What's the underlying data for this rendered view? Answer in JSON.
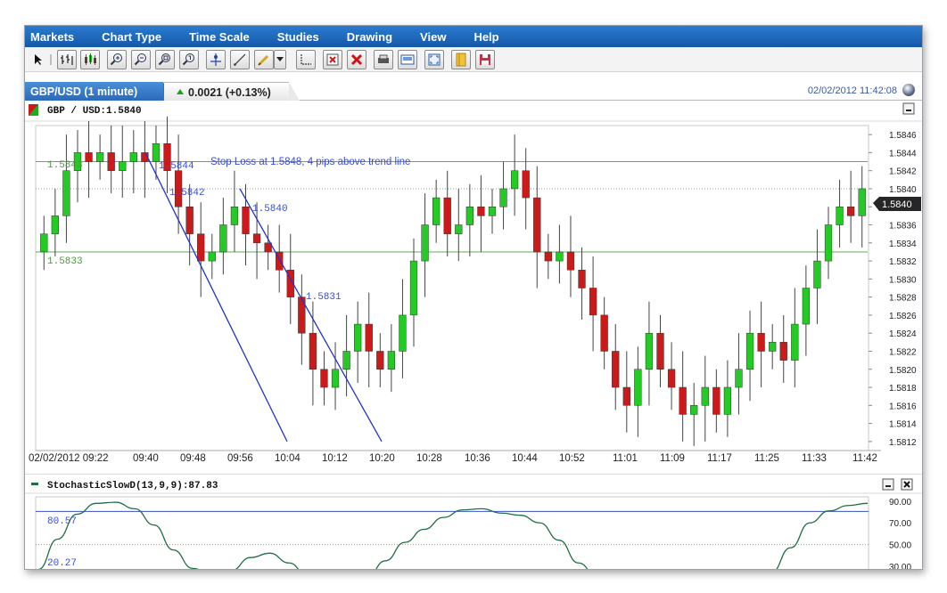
{
  "menu": [
    "Markets",
    "Chart Type",
    "Time Scale",
    "Studies",
    "Drawing",
    "View",
    "Help"
  ],
  "toolbar": {
    "buttons": [
      "pointer-icon",
      "separator-icon",
      "bar-chart-icon",
      "candlestick-icon",
      "zoom-in-icon",
      "zoom-out-icon",
      "zoom-fit-icon",
      "zoom-reset-icon",
      "crosshair-icon",
      "trendline-icon",
      "pencil-icon",
      "dropdown-icon",
      "measure-icon",
      "delete-drawing-icon",
      "delete-all-icon",
      "print-icon",
      "screenshot-icon",
      "fullscreen-icon",
      "template-icon",
      "save-icon"
    ]
  },
  "tab": {
    "label": "GBP/USD (1 minute)",
    "change": "0.0021 (+0.13%)",
    "datetime": "02/02/2012 11:42:08"
  },
  "main_panel": {
    "title": "GBP / USD:1.5840",
    "current_price": "1.5840",
    "price_labels": {
      "top": "1.5843",
      "mid": "1.5833"
    },
    "annotations": [
      {
        "text": "Stop Loss at 1.5848, 4 pips above trend line"
      },
      {
        "text": "1.5844"
      },
      {
        "text": "1.5842"
      },
      {
        "text": "1.5840"
      },
      {
        "text": "1.5831"
      }
    ]
  },
  "lower_panel": {
    "title": "StochasticSlowD(13,9,9):87.83",
    "levels": {
      "upper": "80.57",
      "lower": "20.27"
    },
    "y_ticks": [
      "90.00",
      "70.00",
      "50.00",
      "30.00"
    ]
  },
  "chart_data": {
    "type": "candlestick",
    "title": "GBP / USD:1.5840",
    "x_ticks": [
      "02/02/2012 09:22",
      "09:40",
      "09:48",
      "09:56",
      "10:04",
      "10:12",
      "10:20",
      "10:28",
      "10:36",
      "10:44",
      "10:52",
      "11:01",
      "11:09",
      "11:17",
      "11:25",
      "11:33",
      "11:42"
    ],
    "y_ticks": [
      "1.5846",
      "1.5844",
      "1.5842",
      "1.5840",
      "1.5838",
      "1.5836",
      "1.5834",
      "1.5832",
      "1.5830",
      "1.5828",
      "1.5826",
      "1.5824",
      "1.5822",
      "1.5820",
      "1.5818",
      "1.5816",
      "1.5814",
      "1.5812"
    ],
    "ylim": [
      1.5811,
      1.5847
    ],
    "horizontal_lines": [
      1.5843,
      1.5833
    ],
    "close_path": [
      1.5835,
      1.5837,
      1.5842,
      1.5844,
      1.5843,
      1.5844,
      1.5842,
      1.5843,
      1.5844,
      1.5843,
      1.5845,
      1.5842,
      1.5838,
      1.5835,
      1.5832,
      1.5833,
      1.5836,
      1.5838,
      1.5835,
      1.5834,
      1.5833,
      1.5831,
      1.5828,
      1.5824,
      1.582,
      1.5818,
      1.582,
      1.5822,
      1.5825,
      1.5822,
      1.582,
      1.5822,
      1.5826,
      1.5832,
      1.5836,
      1.5839,
      1.5835,
      1.5836,
      1.5838,
      1.5837,
      1.5838,
      1.584,
      1.5842,
      1.5839,
      1.5833,
      1.5832,
      1.5833,
      1.5831,
      1.5829,
      1.5826,
      1.5822,
      1.5818,
      1.5816,
      1.582,
      1.5824,
      1.582,
      1.5818,
      1.5815,
      1.5816,
      1.5818,
      1.5815,
      1.5818,
      1.582,
      1.5824,
      1.5822,
      1.5823,
      1.5821,
      1.5825,
      1.5829,
      1.5832,
      1.5836,
      1.5838,
      1.5837,
      1.584
    ],
    "trend_lines": [
      {
        "x": [
          "09:40",
          "10:04"
        ],
        "y": [
          1.5844,
          1.5812
        ]
      },
      {
        "x": [
          "09:56",
          "10:20"
        ],
        "y": [
          1.584,
          1.5812
        ]
      }
    ],
    "colors": {
      "up": "#22cc22",
      "down": "#cc1a1a",
      "level_line": "#66aa55",
      "trend_line": "#2233cc"
    }
  },
  "stoch_data": {
    "type": "line",
    "ylim": [
      25,
      94
    ],
    "levels": [
      80.57,
      20.27
    ],
    "values": [
      27,
      55,
      78,
      88,
      89,
      83,
      68,
      45,
      28,
      22,
      26,
      38,
      42,
      33,
      20,
      12,
      10,
      18,
      35,
      52,
      64,
      75,
      82,
      83,
      79,
      77,
      70,
      54,
      33,
      20,
      14,
      14,
      15,
      15,
      14,
      15,
      17,
      18,
      24,
      47,
      70,
      81,
      86,
      88
    ],
    "color": "#1e6e44"
  }
}
